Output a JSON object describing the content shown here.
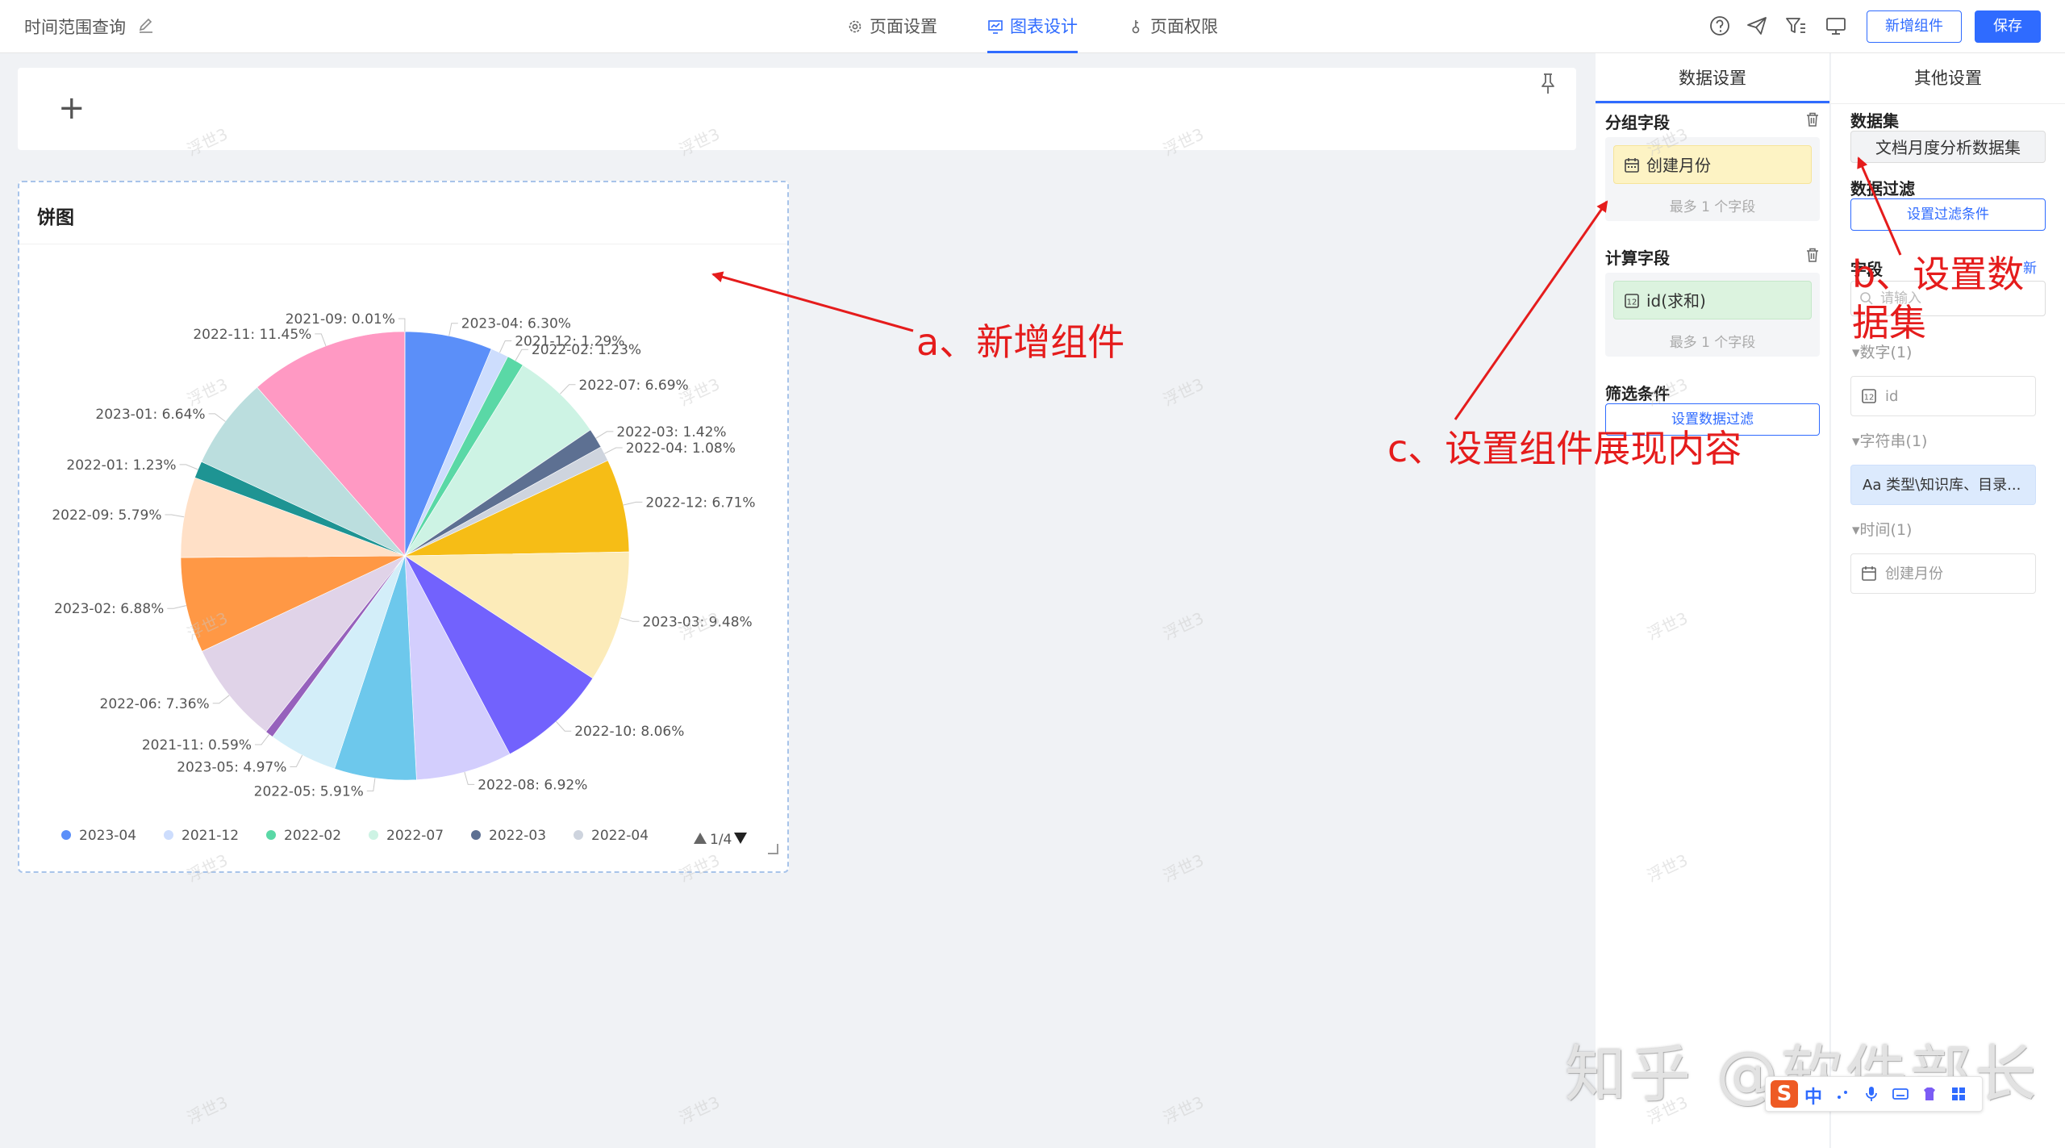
{
  "header": {
    "page_title": "时间范围查询",
    "tabs": [
      {
        "label": "页面设置",
        "icon": "gear-icon",
        "active": false
      },
      {
        "label": "图表设计",
        "icon": "chart-icon",
        "active": true
      },
      {
        "label": "页面权限",
        "icon": "key-icon",
        "active": false
      }
    ],
    "add_component_label": "新增组件",
    "save_label": "保存",
    "accent_color": "#2f6bff"
  },
  "chart_card": {
    "title": "饼图",
    "legend_pager": "1/4"
  },
  "chart_data": {
    "type": "pie",
    "slices": [
      {
        "name": "2023-04",
        "value": 6.3,
        "color": "#5b8ff9"
      },
      {
        "name": "2021-12",
        "value": 1.29,
        "color": "#cdddfd"
      },
      {
        "name": "2022-02",
        "value": 1.23,
        "color": "#5ad8a6"
      },
      {
        "name": "2022-07",
        "value": 6.69,
        "color": "#cdf3e4"
      },
      {
        "name": "2022-03",
        "value": 1.42,
        "color": "#5d7092"
      },
      {
        "name": "2022-04",
        "value": 1.08,
        "color": "#ced4de"
      },
      {
        "name": "2022-12",
        "value": 6.71,
        "color": "#f6bd16"
      },
      {
        "name": "2023-03",
        "value": 9.48,
        "color": "#fcebb9"
      },
      {
        "name": "2022-10",
        "value": 8.06,
        "color": "#7262fd"
      },
      {
        "name": "2022-08",
        "value": 6.92,
        "color": "#d3cefd"
      },
      {
        "name": "2022-05",
        "value": 5.91,
        "color": "#6dc8ec"
      },
      {
        "name": "2023-05",
        "value": 4.97,
        "color": "#d3eef9"
      },
      {
        "name": "2021-11",
        "value": 0.59,
        "color": "#9661bc"
      },
      {
        "name": "2022-06",
        "value": 7.36,
        "color": "#e0d3e8"
      },
      {
        "name": "2023-02",
        "value": 6.88,
        "color": "#ff9845"
      },
      {
        "name": "2022-09",
        "value": 5.79,
        "color": "#ffe0c7"
      },
      {
        "name": "2022-01",
        "value": 1.23,
        "color": "#1e9493"
      },
      {
        "name": "2023-01",
        "value": 6.64,
        "color": "#bbdede"
      },
      {
        "name": "2022-11",
        "value": 11.45,
        "color": "#ff99c3"
      },
      {
        "name": "2021-09",
        "value": 0.01,
        "color": "#ffd6e7"
      }
    ],
    "legend_visible": [
      "2023-04",
      "2021-12",
      "2022-02",
      "2022-07",
      "2022-03",
      "2022-04"
    ],
    "legend_position": "bottom"
  },
  "data_panel": {
    "tab_label": "数据设置",
    "group_field_title": "分组字段",
    "group_field_chip": "创建月份",
    "group_field_hint": "最多 1 个字段",
    "calc_field_title": "计算字段",
    "calc_field_chip": "id(求和)",
    "calc_field_hint": "最多 1 个字段",
    "filter_title": "筛选条件",
    "filter_button": "设置数据过滤"
  },
  "other_panel": {
    "tab_label": "其他设置",
    "dataset_title": "数据集",
    "dataset_value": "文档月度分析数据集",
    "data_filter_title": "数据过滤",
    "data_filter_button": "设置过滤条件",
    "fields_title": "字段",
    "new_link": "新",
    "search_placeholder": "请输入",
    "number_group": "数字(1)",
    "number_field": "id",
    "string_group": "字符串(1)",
    "string_field": "Aa 类型\\知识库、目录...",
    "time_group": "时间(1)",
    "time_field": "创建月份"
  },
  "annotations": {
    "a": "a、新增组件",
    "b_line1": "b、设置数",
    "b_line2": "据集",
    "c": "c、设置组件展现内容",
    "color": "#e51c1c"
  },
  "watermarks": {
    "canvas_tile": "浮世3",
    "site": "知乎 @软件部长"
  },
  "ime": {
    "lang": "中"
  }
}
